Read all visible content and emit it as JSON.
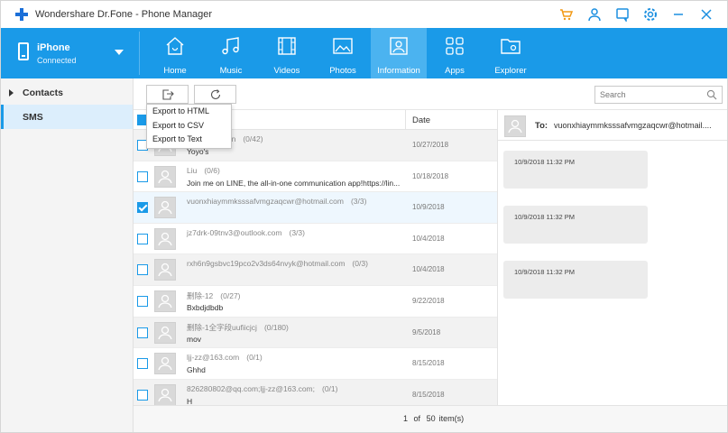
{
  "app": {
    "title": "Wondershare Dr.Fone - Phone Manager"
  },
  "title_icons": [
    "cart-icon",
    "user-icon",
    "feedback-icon",
    "settings-icon",
    "minimize-icon",
    "close-icon"
  ],
  "device": {
    "name": "iPhone",
    "status": "Connected"
  },
  "nav": {
    "tabs": [
      {
        "label": "Home",
        "icon": "home-icon"
      },
      {
        "label": "Music",
        "icon": "music-icon"
      },
      {
        "label": "Videos",
        "icon": "film-icon"
      },
      {
        "label": "Photos",
        "icon": "picture-icon"
      },
      {
        "label": "Information",
        "icon": "contact-card-icon",
        "active": true
      },
      {
        "label": "Apps",
        "icon": "apps-icon"
      },
      {
        "label": "Explorer",
        "icon": "folder-gear-icon"
      }
    ]
  },
  "sidebar": {
    "items": [
      {
        "label": "Contacts"
      },
      {
        "label": "SMS",
        "active": true
      }
    ]
  },
  "toolbar": {
    "export_icon": "export-icon",
    "refresh_icon": "refresh-icon",
    "search_placeholder": "Search"
  },
  "export_menu": {
    "items": [
      "Export to HTML",
      "Export to CSV",
      "Export to Text"
    ]
  },
  "list": {
    "date_header": "Date",
    "rows": [
      {
        "name": "ondershare.cn",
        "count": "(0/42)",
        "message": "Yoyo's",
        "date": "10/27/2018",
        "checked": false
      },
      {
        "name": "Liu",
        "count": "(0/6)",
        "message": "Join me on LINE, the all-in-one communication app!https://lin...",
        "date": "10/18/2018",
        "checked": false
      },
      {
        "name": "vuonxhiaymmksssafvmgzaqcwr@hotmail.com",
        "count": "(3/3)",
        "message": "",
        "date": "10/9/2018",
        "checked": true
      },
      {
        "name": "jz7drk-09tnv3@outlook.com",
        "count": "(3/3)",
        "message": "",
        "date": "10/4/2018",
        "checked": false
      },
      {
        "name": "rxh6n9gsbvc19pco2v3ds64nvyk@hotmail.com",
        "count": "(0/3)",
        "message": "",
        "date": "10/4/2018",
        "checked": false
      },
      {
        "name": "删除-12",
        "count": "(0/27)",
        "message": "Bxbdjdbdb",
        "date": "9/22/2018",
        "checked": false
      },
      {
        "name": "删除-1全字段uufiicjcj",
        "count": "(0/180)",
        "message": "mov",
        "date": "9/5/2018",
        "checked": false
      },
      {
        "name": "ljj-zz@163.com",
        "count": "(0/1)",
        "message": "Ghhd",
        "date": "8/15/2018",
        "checked": false
      },
      {
        "name": "826280802@qq.com;ljj-zz@163.com;",
        "count": "(0/1)",
        "message": "H",
        "date": "8/15/2018",
        "checked": false
      }
    ]
  },
  "pager": {
    "current": "1",
    "of_label": "of",
    "total": "50",
    "unit": "item(s)"
  },
  "detail": {
    "to_label": "To:",
    "to_value": "vuonxhiaymmksssafvmgzaqcwr@hotmail....",
    "messages": [
      "10/9/2018 11:32 PM",
      "10/9/2018 11:32 PM",
      "10/9/2018 11:32 PM"
    ]
  },
  "colors": {
    "accent": "#1a9ae8",
    "active_tab": "#4bb3f0",
    "cart": "#f29a17"
  }
}
